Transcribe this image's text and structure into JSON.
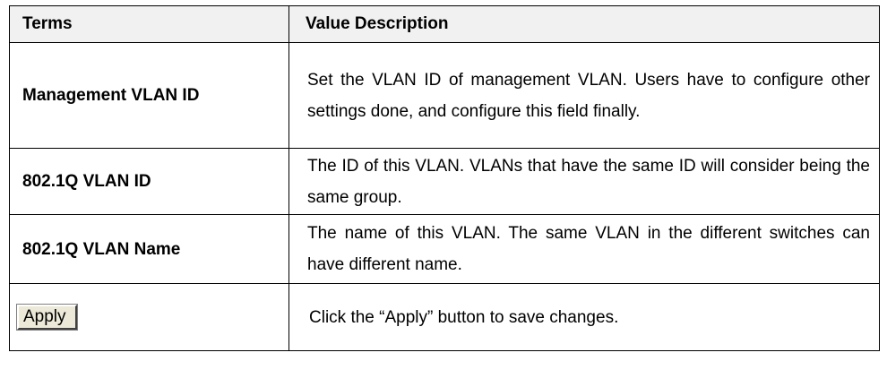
{
  "table": {
    "header": {
      "terms": "Terms",
      "value_description": "Value Description"
    },
    "rows": [
      {
        "term": "Management VLAN ID",
        "description": "Set the VLAN ID of management VLAN. Users have to configure other settings done, and configure this field finally."
      },
      {
        "term": "802.1Q VLAN ID",
        "description": "The ID of this VLAN. VLANs that have the same ID will consider being the same group."
      },
      {
        "term": "802.1Q VLAN Name",
        "description": "The name of this VLAN. The same VLAN in the different switches can have different name."
      }
    ],
    "apply_row": {
      "button_label": "Apply",
      "description": "Click the “Apply” button to save changes."
    }
  }
}
